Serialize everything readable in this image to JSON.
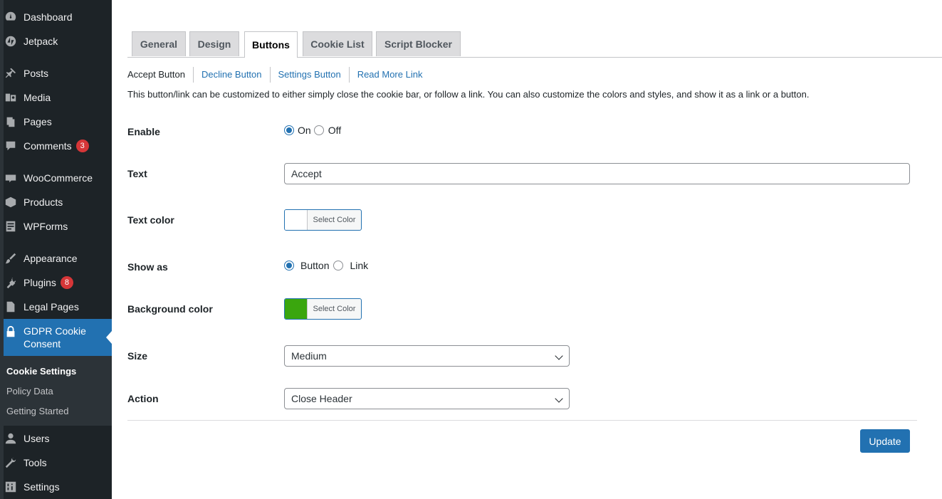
{
  "sidebar": {
    "items": [
      {
        "label": "Dashboard",
        "icon": "dashboard-icon"
      },
      {
        "label": "Jetpack",
        "icon": "jetpack-icon"
      },
      {
        "label": "Posts",
        "icon": "pin-icon"
      },
      {
        "label": "Media",
        "icon": "media-icon"
      },
      {
        "label": "Pages",
        "icon": "pages-icon"
      },
      {
        "label": "Comments",
        "icon": "comments-icon",
        "badge": "3"
      },
      {
        "label": "WooCommerce",
        "icon": "woocommerce-icon"
      },
      {
        "label": "Products",
        "icon": "products-icon"
      },
      {
        "label": "WPForms",
        "icon": "forms-icon"
      },
      {
        "label": "Appearance",
        "icon": "brush-icon"
      },
      {
        "label": "Plugins",
        "icon": "plugin-icon",
        "badge": "8"
      },
      {
        "label": "Legal Pages",
        "icon": "document-icon"
      },
      {
        "label": "Users",
        "icon": "user-icon"
      },
      {
        "label": "Tools",
        "icon": "wrench-icon"
      },
      {
        "label": "Settings",
        "icon": "settings-icon"
      }
    ],
    "active": {
      "label": "GDPR Cookie Consent",
      "icon": "lock-icon"
    },
    "submenu": [
      "Cookie Settings",
      "Policy Data",
      "Getting Started"
    ]
  },
  "tabs": [
    "General",
    "Design",
    "Buttons",
    "Cookie List",
    "Script Blocker"
  ],
  "subnav": [
    "Accept Button",
    "Decline Button",
    "Settings Button",
    "Read More Link"
  ],
  "description": "This button/link can be customized to either simply close the cookie bar, or follow a link. You can also customize the colors and styles, and show it as a link or a button.",
  "form": {
    "enable": {
      "label": "Enable",
      "on": "On",
      "off": "Off"
    },
    "text": {
      "label": "Text",
      "value": "Accept"
    },
    "text_color": {
      "label": "Text color",
      "button": "Select Color",
      "swatch": "#ffffff"
    },
    "show_as": {
      "label": "Show as",
      "button": "Button",
      "link": "Link"
    },
    "bg_color": {
      "label": "Background color",
      "button": "Select Color",
      "swatch": "#3aa60e"
    },
    "size": {
      "label": "Size",
      "value": "Medium"
    },
    "action": {
      "label": "Action",
      "value": "Close Header"
    }
  },
  "update_label": "Update",
  "colors": {
    "accent": "#2271b1",
    "sidebar": "#1d2327",
    "badge": "#d63638"
  }
}
